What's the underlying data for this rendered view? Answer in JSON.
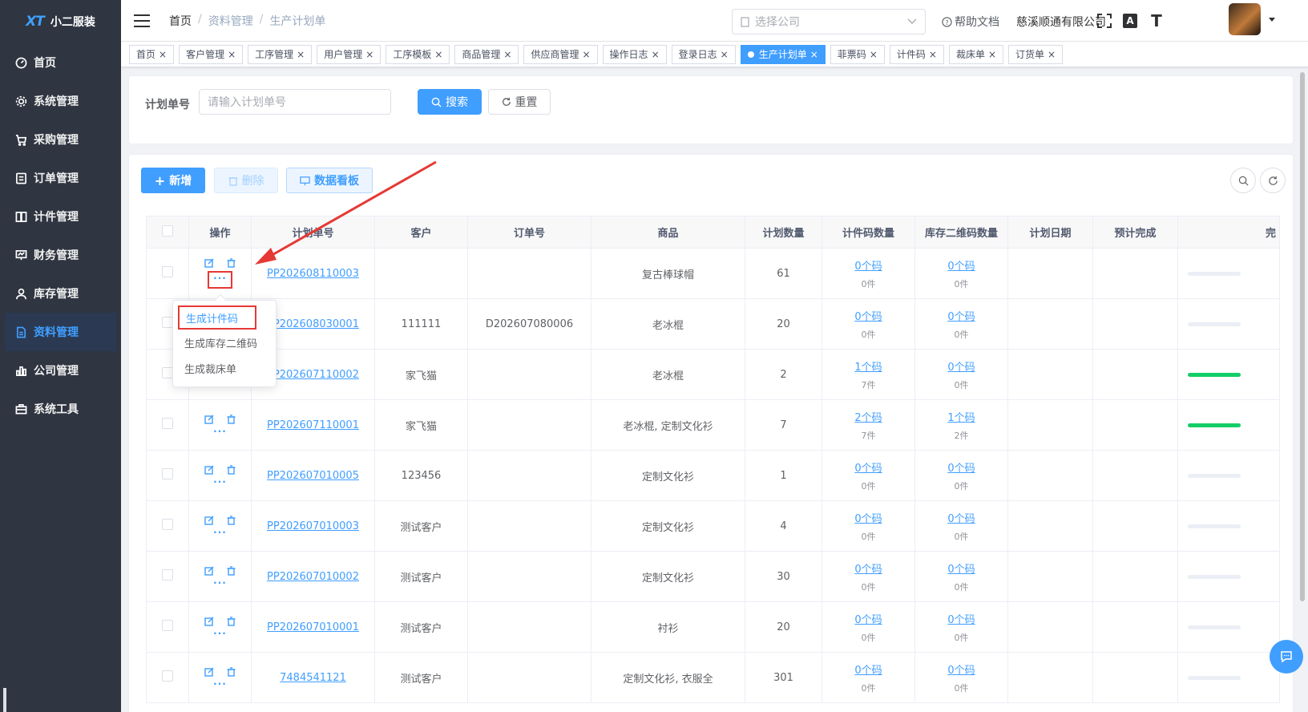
{
  "app": {
    "logo_mark": "XT",
    "logo_text": "小二服装"
  },
  "sidebar": {
    "items": [
      {
        "label": "首页",
        "icon": "dashboard-icon"
      },
      {
        "label": "系统管理",
        "icon": "gear-icon"
      },
      {
        "label": "采购管理",
        "icon": "cart-icon"
      },
      {
        "label": "订单管理",
        "icon": "order-icon"
      },
      {
        "label": "计件管理",
        "icon": "book-icon"
      },
      {
        "label": "财务管理",
        "icon": "finance-icon"
      },
      {
        "label": "库存管理",
        "icon": "person-icon"
      },
      {
        "label": "资料管理",
        "icon": "document-icon"
      },
      {
        "label": "公司管理",
        "icon": "chart-icon"
      },
      {
        "label": "系统工具",
        "icon": "toolbox-icon"
      }
    ],
    "active_index": 7
  },
  "header": {
    "breadcrumb": [
      "首页",
      "资料管理",
      "生产计划单"
    ],
    "breadcrumb_sep": "/",
    "company_select_placeholder": "选择公司",
    "help_label": "帮助文档",
    "company_name": "慈溪顺通有限公司",
    "lang_icon_label": "A",
    "font_icon_label": "T"
  },
  "tags": [
    {
      "label": "首页",
      "active": false
    },
    {
      "label": "客户管理",
      "active": false
    },
    {
      "label": "工序管理",
      "active": false
    },
    {
      "label": "用户管理",
      "active": false
    },
    {
      "label": "工序模板",
      "active": false
    },
    {
      "label": "商品管理",
      "active": false
    },
    {
      "label": "供应商管理",
      "active": false
    },
    {
      "label": "操作日志",
      "active": false
    },
    {
      "label": "登录日志",
      "active": false
    },
    {
      "label": "生产计划单",
      "active": true
    },
    {
      "label": "菲票码",
      "active": false
    },
    {
      "label": "计件码",
      "active": false
    },
    {
      "label": "裁床单",
      "active": false
    },
    {
      "label": "订货单",
      "active": false
    }
  ],
  "search": {
    "label": "计划单号",
    "placeholder": "请输入计划单号",
    "search_button": "搜索",
    "reset_button": "重置"
  },
  "toolbar": {
    "add_label": "新增",
    "delete_label": "删除",
    "board_label": "数据看板"
  },
  "table": {
    "columns": [
      "操作",
      "计划单号",
      "客户",
      "订单号",
      "商品",
      "计划数量",
      "计件码数量",
      "库存二维码数量",
      "计划日期",
      "预计完成",
      "完"
    ],
    "more_label": "···",
    "rows": [
      {
        "plan_no": "PP202608110003",
        "customer": "",
        "order_no": "",
        "product": "复古棒球帽",
        "qty": "61",
        "piece_codes": "0个码",
        "piece_count": "0件",
        "stock_codes": "0个码",
        "stock_count": "0件",
        "progress": 0.0
      },
      {
        "plan_no": "PP202608030001",
        "customer": "111111",
        "order_no": "D202607080006",
        "product": "老冰棍",
        "qty": "20",
        "piece_codes": "0个码",
        "piece_count": "0件",
        "stock_codes": "0个码",
        "stock_count": "0件",
        "progress": 0.0
      },
      {
        "plan_no": "PP202607110002",
        "customer": "家飞猫",
        "order_no": "",
        "product": "老冰棍",
        "qty": "2",
        "piece_codes": "1个码",
        "piece_count": "7件",
        "stock_codes": "0个码",
        "stock_count": "0件",
        "progress": 1.0
      },
      {
        "plan_no": "PP202607110001",
        "customer": "家飞猫",
        "order_no": "",
        "product": "老冰棍, 定制文化衫",
        "qty": "7",
        "piece_codes": "2个码",
        "piece_count": "7件",
        "stock_codes": "1个码",
        "stock_count": "2件",
        "progress": 1.0
      },
      {
        "plan_no": "PP202607010005",
        "customer": "123456",
        "order_no": "",
        "product": "定制文化衫",
        "qty": "1",
        "piece_codes": "0个码",
        "piece_count": "0件",
        "stock_codes": "0个码",
        "stock_count": "0件",
        "progress": 0.0
      },
      {
        "plan_no": "PP202607010003",
        "customer": "测试客户",
        "order_no": "",
        "product": "定制文化衫",
        "qty": "4",
        "piece_codes": "0个码",
        "piece_count": "0件",
        "stock_codes": "0个码",
        "stock_count": "0件",
        "progress": 0.0
      },
      {
        "plan_no": "PP202607010002",
        "customer": "测试客户",
        "order_no": "",
        "product": "定制文化衫",
        "qty": "30",
        "piece_codes": "0个码",
        "piece_count": "0件",
        "stock_codes": "0个码",
        "stock_count": "0件",
        "progress": 0.0
      },
      {
        "plan_no": "PP202607010001",
        "customer": "测试客户",
        "order_no": "",
        "product": "衬衫",
        "qty": "20",
        "piece_codes": "0个码",
        "piece_count": "0件",
        "stock_codes": "0个码",
        "stock_count": "0件",
        "progress": 0.0
      },
      {
        "plan_no": "7484541121",
        "customer": "测试客户",
        "order_no": "",
        "product": "定制文化衫, 衣服全",
        "qty": "301",
        "piece_codes": "0个码",
        "piece_count": "0件",
        "stock_codes": "0个码",
        "stock_count": "0件",
        "progress": 0.0
      }
    ]
  },
  "dropdown": {
    "items": [
      "生成计件码",
      "生成库存二维码",
      "生成裁床单"
    ],
    "highlighted_index": 0
  },
  "colors": {
    "primary": "#409eff",
    "sidebar_bg": "#2f3541",
    "success": "#13ce66",
    "annotation_red": "#e53935"
  }
}
